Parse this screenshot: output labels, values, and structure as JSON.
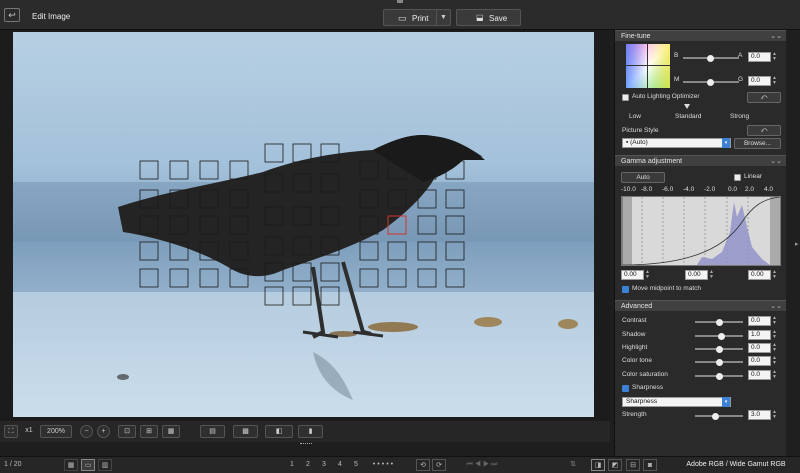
{
  "titlebar": {
    "title": "Edit Image",
    "print_label": "Print",
    "save_label": "Save"
  },
  "viewer_toolbar": {
    "zoom_reset": "x1",
    "zoom_value": "200%"
  },
  "fine_tune": {
    "header": "Fine-tune",
    "b_label": "B",
    "a_label": "A",
    "m_label": "M",
    "g_label": "G",
    "a_value": "0.0",
    "g_value": "0.0",
    "auto_lighting_label": "Auto Lighting Optimizer",
    "levels": [
      "Low",
      "Standard",
      "Strong"
    ],
    "picture_style_label": "Picture Style",
    "picture_style_value": "(Auto)",
    "browse_label": "Browse..."
  },
  "gamma": {
    "header": "Gamma adjustment",
    "auto_label": "Auto",
    "linear_label": "Linear",
    "ticks": [
      "-10.0",
      "-8.0",
      "-6.0",
      "-4.0",
      "-2.0",
      "0.0",
      "2.0",
      "4.0"
    ],
    "values": [
      "0.00",
      "0.00",
      "0.00"
    ],
    "move_midpoint_label": "Move midpoint to match"
  },
  "advanced": {
    "header": "Advanced",
    "rows": [
      {
        "label": "Contrast",
        "value": "0.0",
        "level": 0.5
      },
      {
        "label": "Shadow",
        "value": "1.0",
        "level": 0.55
      },
      {
        "label": "Highlight",
        "value": "0.0",
        "level": 0.5
      },
      {
        "label": "Color tone",
        "value": "0.0",
        "level": 0.5
      },
      {
        "label": "Color saturation",
        "value": "0.0",
        "level": 0.5
      }
    ],
    "sharpness_label": "Sharpness",
    "sharpness_select": "Sharpness",
    "strength_label": "Strength",
    "strength_value": "3.0",
    "strength_level": 0.43
  },
  "statusbar": {
    "page": "1 / 20",
    "star_buttons": [
      "1",
      "2",
      "3",
      "4",
      "5"
    ],
    "color_space": "Adobe RGB / Wide Gamut RGB"
  },
  "colors": {
    "accent": "#3b82d6",
    "af_point_active": "#d0342c"
  },
  "icons": [
    "back-icon",
    "printer-icon",
    "save-icon",
    "zoom-out-icon",
    "zoom-in-icon",
    "rotate-icon",
    "camera-icon",
    "reset-icon"
  ]
}
